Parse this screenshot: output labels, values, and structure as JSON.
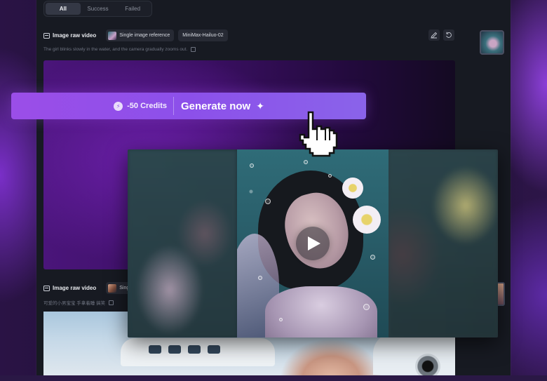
{
  "filter_tabs": [
    {
      "label": "All",
      "active": true
    },
    {
      "label": "Success",
      "active": false
    },
    {
      "label": "Failed",
      "active": false
    }
  ],
  "tasks": [
    {
      "title": "Image raw video",
      "mode_chip": "Single image reference",
      "model_chip": "MiniMax-Hailuo-02",
      "prompt": "The girl blinks slowly in the water, and the camera gradually zooms out."
    },
    {
      "title": "Image raw video",
      "mode_chip": "Single",
      "prompt": "可爱的小男宝宝 手拿着睡 搞笑"
    }
  ],
  "generate": {
    "credits": "-50 Credits",
    "label": "Generate now"
  },
  "icons": {
    "edit": "pencil-icon",
    "regenerate": "refresh-icon",
    "credits": "credit-coin-icon",
    "sparkle": "sparkle-icon",
    "cursor": "hand-pointer-icon",
    "play": "play-icon",
    "copy": "copy-icon",
    "video": "film-icon"
  },
  "colors": {
    "accent_start": "#9b4ee8",
    "accent_end": "#8a63ea",
    "panel_bg": "#171a22",
    "chip_bg": "#272a34"
  }
}
